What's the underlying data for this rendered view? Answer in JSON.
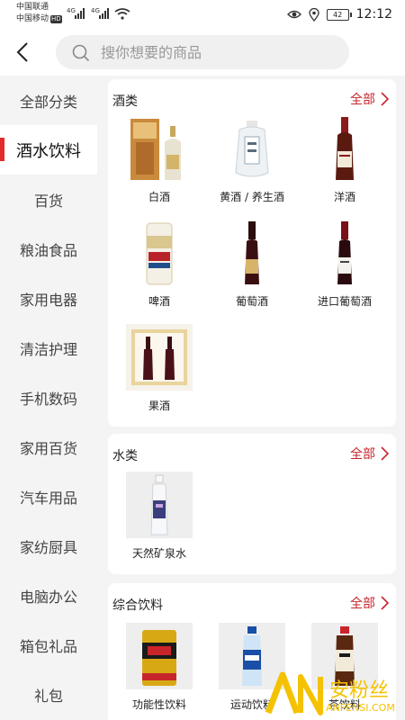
{
  "status_bar": {
    "carrier1": "中国联通",
    "carrier2": "中国移动",
    "hd_badge": "HD",
    "network1": "4G",
    "network2": "4G",
    "battery": "42",
    "time": "12:12",
    "icons": [
      "eye-icon",
      "location-icon",
      "wifi-icon",
      "signal-icon",
      "battery-icon"
    ]
  },
  "search": {
    "placeholder": "搜你想要的商品"
  },
  "sidebar": {
    "items": [
      {
        "label": "全部分类"
      },
      {
        "label": "酒水饮料",
        "active": true
      },
      {
        "label": "百货"
      },
      {
        "label": "粮油食品"
      },
      {
        "label": "家用电器"
      },
      {
        "label": "清洁护理"
      },
      {
        "label": "手机数码"
      },
      {
        "label": "家用百货"
      },
      {
        "label": "汽车用品"
      },
      {
        "label": "家纺厨具"
      },
      {
        "label": "电脑办公"
      },
      {
        "label": "箱包礼品"
      },
      {
        "label": "礼包"
      }
    ]
  },
  "sections": {
    "liquor": {
      "title": "酒类",
      "more": "全部",
      "items": [
        {
          "label": "白酒"
        },
        {
          "label": "黄酒 / 养生酒"
        },
        {
          "label": "洋酒"
        },
        {
          "label": "啤酒"
        },
        {
          "label": "葡萄酒"
        },
        {
          "label": "进口葡萄酒"
        },
        {
          "label": "果酒"
        }
      ]
    },
    "water": {
      "title": "水类",
      "more": "全部",
      "items": [
        {
          "label": "天然矿泉水"
        }
      ]
    },
    "drinks": {
      "title": "综合饮料",
      "more": "全部",
      "items": [
        {
          "label": "功能性饮料"
        },
        {
          "label": "运动饮料"
        },
        {
          "label": "茶饮料"
        }
      ]
    }
  },
  "watermark": {
    "brand": "安粉丝",
    "url": "ANFENSI.COM"
  },
  "colors": {
    "accent": "#c4262e",
    "active_bar": "#e22b2b",
    "background": "#f4f4f4"
  }
}
